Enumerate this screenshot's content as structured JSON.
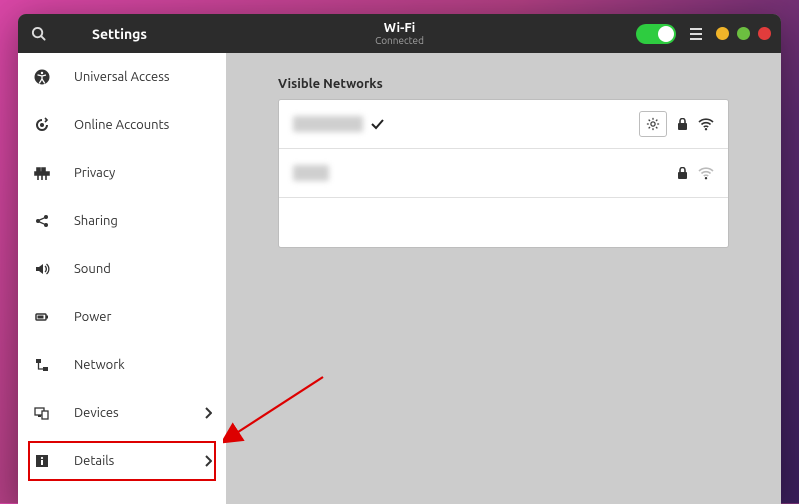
{
  "header": {
    "app_title": "Settings",
    "wifi_title": "Wi-Fi",
    "wifi_status": "Connected"
  },
  "sidebar": {
    "items": [
      {
        "icon": "accessibility-icon",
        "label": "Universal Access",
        "chevron": false
      },
      {
        "icon": "online-accounts-icon",
        "label": "Online Accounts",
        "chevron": false
      },
      {
        "icon": "privacy-icon",
        "label": "Privacy",
        "chevron": false
      },
      {
        "icon": "sharing-icon",
        "label": "Sharing",
        "chevron": false
      },
      {
        "icon": "sound-icon",
        "label": "Sound",
        "chevron": false
      },
      {
        "icon": "power-icon",
        "label": "Power",
        "chevron": false
      },
      {
        "icon": "network-icon",
        "label": "Network",
        "chevron": false
      },
      {
        "icon": "devices-icon",
        "label": "Devices",
        "chevron": true
      },
      {
        "icon": "details-icon",
        "label": "Details",
        "chevron": true,
        "highlighted": true
      }
    ]
  },
  "main": {
    "section_title": "Visible Networks",
    "networks": [
      {
        "ssid": "(redacted)",
        "connected": true,
        "locked": true,
        "strength": "strong",
        "gear": true
      },
      {
        "ssid": "(redacted)",
        "connected": false,
        "locked": true,
        "strength": "weak",
        "gear": false
      }
    ]
  }
}
